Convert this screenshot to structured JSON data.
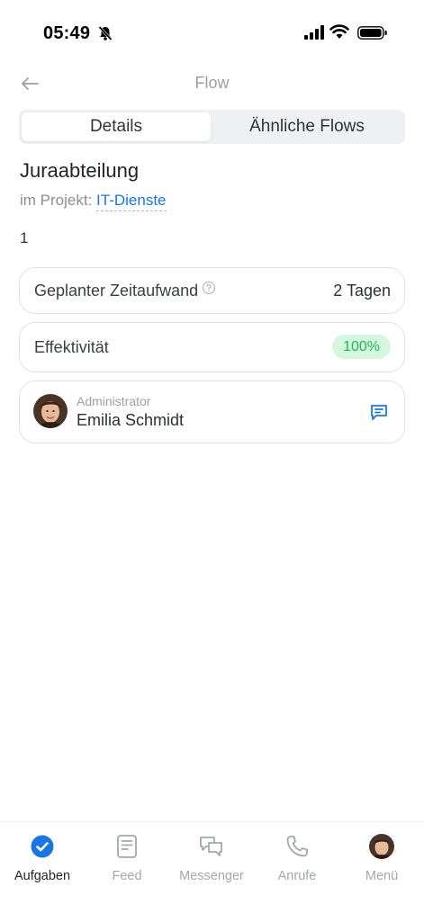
{
  "status_bar": {
    "time": "05:49"
  },
  "nav": {
    "title": "Flow"
  },
  "segments": {
    "details": "Details",
    "similar": "Ähnliche Flows"
  },
  "flow": {
    "name": "Juraabteilung",
    "project_prefix": "im Projekt: ",
    "project_name": "IT-Dienste",
    "description": "1"
  },
  "cards": {
    "planned_label": "Geplanter Zeitaufwand",
    "planned_value": "2 Tagen",
    "efficiency_label": "Effektivität",
    "efficiency_value": "100%",
    "admin_role": "Administrator",
    "admin_name": "Emilia Schmidt"
  },
  "tabbar": {
    "tasks": "Aufgaben",
    "feed": "Feed",
    "messenger": "Messenger",
    "calls": "Anrufe",
    "menu": "Menü"
  },
  "colors": {
    "accent": "#1a73e8",
    "active_tab": "#1976e6",
    "badge_bg": "#d5f7df",
    "badge_text": "#1fb84f"
  }
}
